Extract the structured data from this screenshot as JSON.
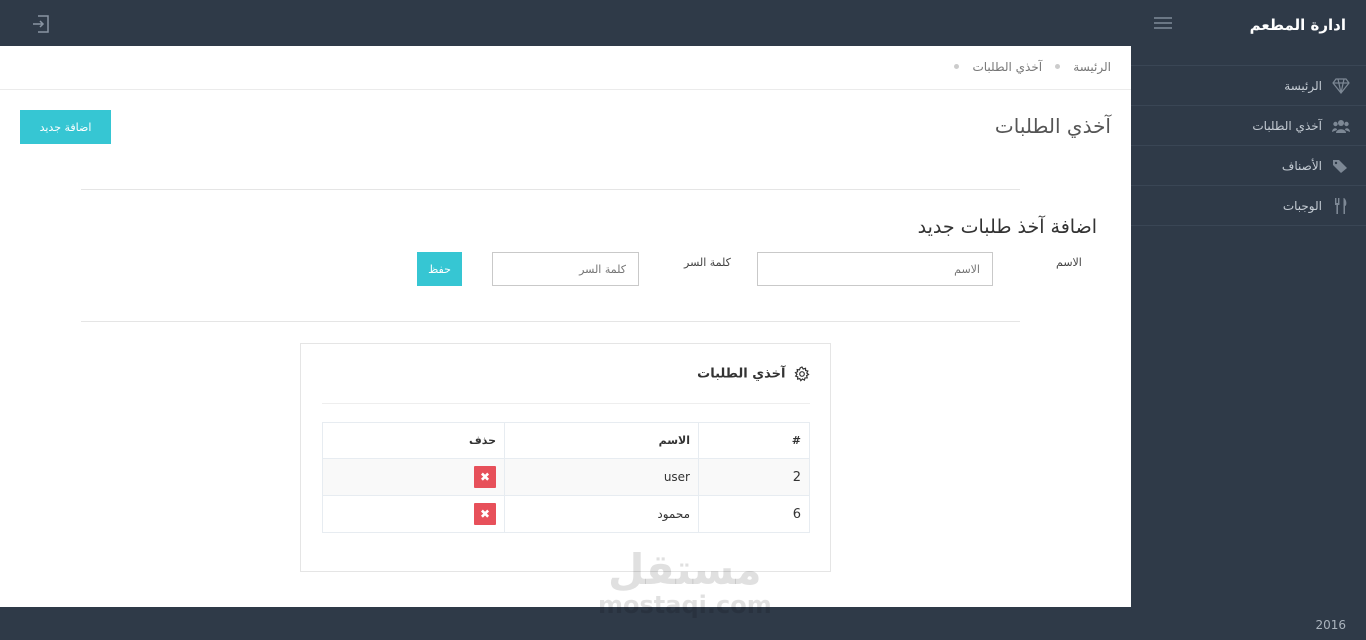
{
  "header": {
    "brand": "ادارة المطعم",
    "menu_icon": "hamburger-icon",
    "logout_icon": "logout-icon"
  },
  "sidebar": {
    "items": [
      {
        "label": "الرئيسة",
        "icon": "diamond-icon"
      },
      {
        "label": "آخذي الطلبات",
        "icon": "users-icon"
      },
      {
        "label": "الأصناف",
        "icon": "tags-icon"
      },
      {
        "label": "الوجبات",
        "icon": "cutlery-icon"
      }
    ],
    "footer_year": "2016"
  },
  "breadcrumb": {
    "home": "الرئيسة",
    "current": "آخذي الطلبات"
  },
  "page": {
    "title": "آخذي الطلبات",
    "add_button": "اضافة جديد"
  },
  "form": {
    "title": "اضافة آخذ طلبات جديد",
    "name_label": "الاسم",
    "name_placeholder": "الاسم",
    "password_label": "كلمة السر",
    "password_placeholder": "كلمة السر",
    "save_button": "حفظ"
  },
  "portlet": {
    "title": "آخذي الطلبات",
    "icon": "gear-icon"
  },
  "table": {
    "headers": [
      "#",
      "الاسم",
      "حذف"
    ],
    "rows": [
      {
        "id": "2",
        "name": "user"
      },
      {
        "id": "6",
        "name": "محمود"
      }
    ],
    "delete_symbol": "✖"
  },
  "watermark": {
    "line1": "مستقل",
    "line2": "mostaqi.com"
  },
  "colors": {
    "dark": "#2f3a48",
    "accent": "#36c6d3",
    "danger": "#e7505a"
  }
}
